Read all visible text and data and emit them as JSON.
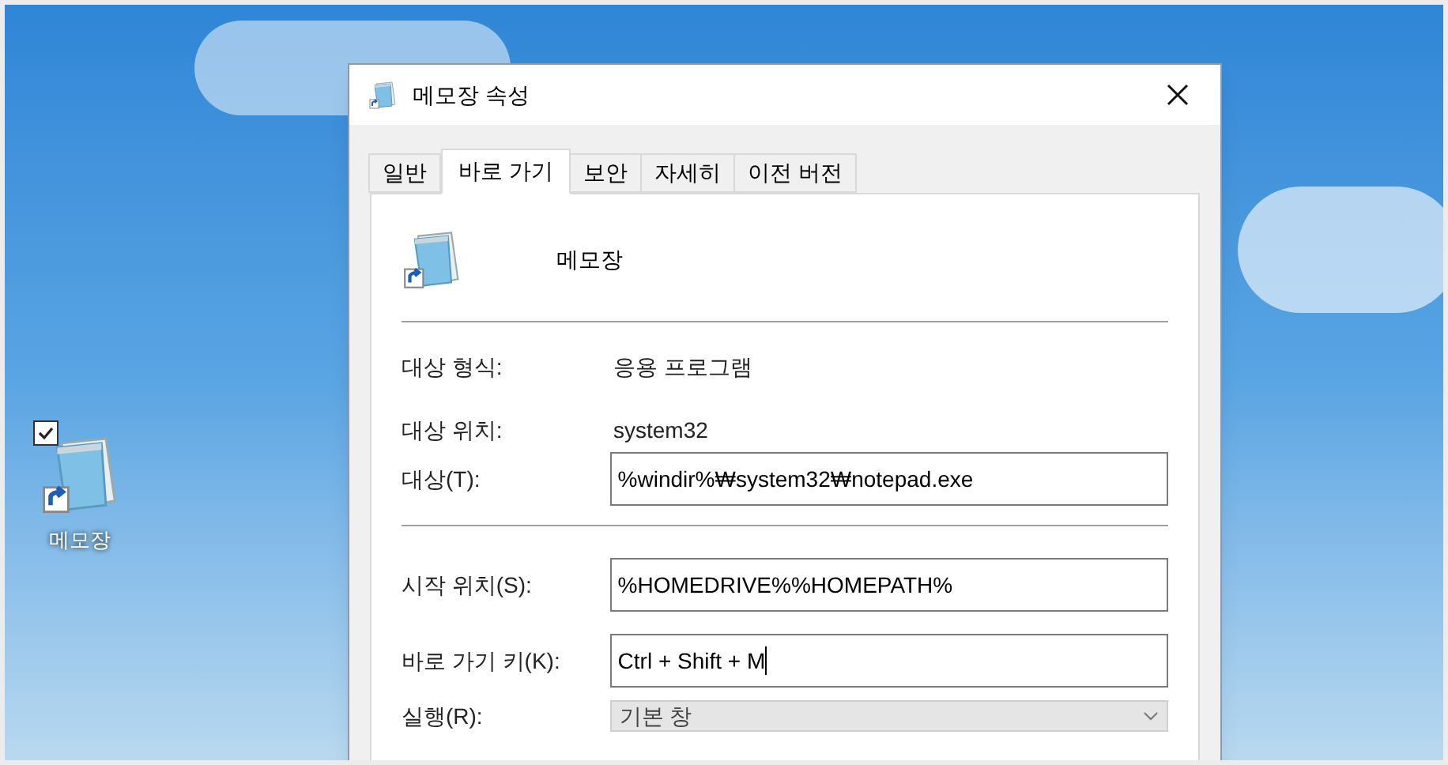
{
  "desktop": {
    "icon": {
      "label": "메모장",
      "checked": true
    }
  },
  "window": {
    "title": "메모장 속성"
  },
  "tabs": [
    {
      "label": "일반",
      "selected": false
    },
    {
      "label": "바로 가기",
      "selected": true
    },
    {
      "label": "보안",
      "selected": false
    },
    {
      "label": "자세히",
      "selected": false
    },
    {
      "label": "이전 버전",
      "selected": false
    }
  ],
  "shortcut": {
    "name": "메모장"
  },
  "info": [
    {
      "label": "대상 형식:",
      "value": "응용 프로그램"
    },
    {
      "label": "대상 위치:",
      "value": "system32"
    }
  ],
  "fields": [
    {
      "kind": "text",
      "label": "대상(T):",
      "value": "%windir%₩system32₩notepad.exe",
      "separator_after": true
    },
    {
      "kind": "text",
      "label": "시작 위치(S):",
      "value": "%HOMEDRIVE%%HOMEPATH%"
    },
    {
      "kind": "text",
      "label": "바로 가기 키(K):",
      "value": "Ctrl + Shift + M",
      "focused": true
    },
    {
      "kind": "select",
      "label": "실행(R):",
      "value": "기본 창"
    }
  ]
}
